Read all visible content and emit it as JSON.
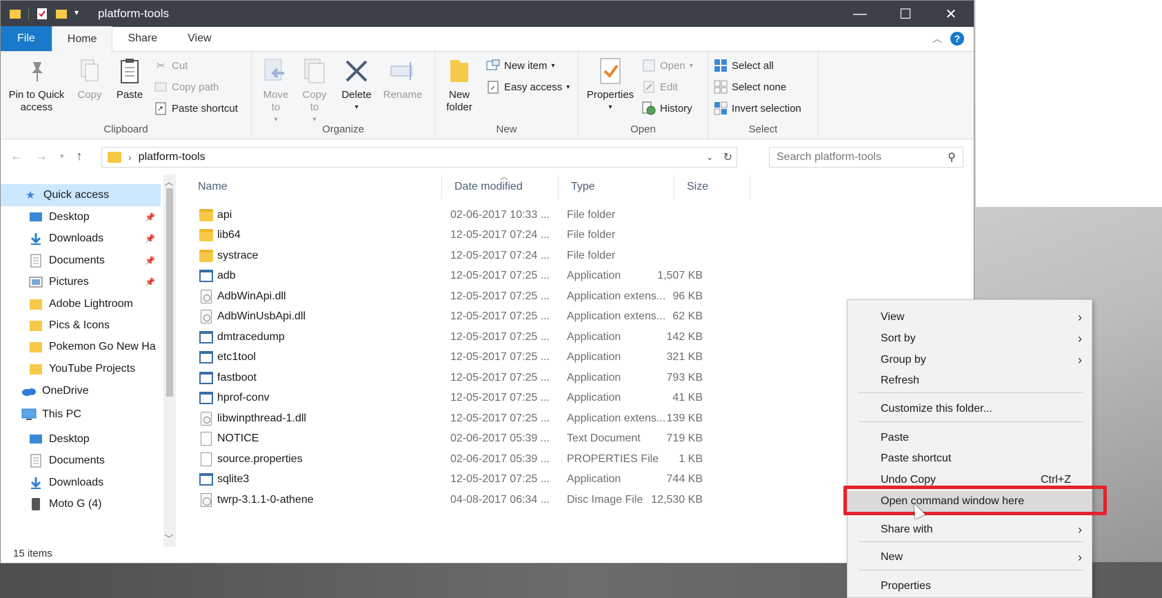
{
  "window": {
    "title": "platform-tools",
    "controls": {
      "minimize": "—",
      "maximize": "☐",
      "close": "✕"
    }
  },
  "ribbon": {
    "tabs": [
      "File",
      "Home",
      "Share",
      "View"
    ],
    "active_tab": "Home",
    "clipboard": {
      "label": "Clipboard",
      "pin": "Pin to Quick access",
      "copy": "Copy",
      "paste": "Paste",
      "cut": "Cut",
      "copy_path": "Copy path",
      "paste_shortcut": "Paste shortcut"
    },
    "organize": {
      "label": "Organize",
      "move_to": "Move to",
      "copy_to": "Copy to",
      "delete": "Delete",
      "rename": "Rename"
    },
    "new": {
      "label": "New",
      "new_folder": "New folder",
      "new_item": "New item",
      "easy_access": "Easy access"
    },
    "open": {
      "label": "Open",
      "properties": "Properties",
      "open": "Open",
      "edit": "Edit",
      "history": "History"
    },
    "select": {
      "label": "Select",
      "select_all": "Select all",
      "select_none": "Select none",
      "invert_selection": "Invert selection"
    }
  },
  "address": {
    "path": "platform-tools",
    "search_placeholder": "Search platform-tools"
  },
  "nav": {
    "quick_access": "Quick access",
    "items": [
      {
        "label": "Desktop",
        "icon": "desktop-icon",
        "pinned": true
      },
      {
        "label": "Downloads",
        "icon": "download-icon",
        "pinned": true
      },
      {
        "label": "Documents",
        "icon": "documents-icon",
        "pinned": true
      },
      {
        "label": "Pictures",
        "icon": "pictures-icon",
        "pinned": true
      },
      {
        "label": "Adobe Lightroom",
        "icon": "folder-icon",
        "pinned": false
      },
      {
        "label": "Pics & Icons",
        "icon": "folder-icon",
        "pinned": false
      },
      {
        "label": "Pokemon Go New Ha",
        "icon": "folder-icon",
        "pinned": false
      },
      {
        "label": "YouTube Projects",
        "icon": "folder-icon",
        "pinned": false
      }
    ],
    "onedrive": "OneDrive",
    "this_pc": "This PC",
    "pc_items": [
      {
        "label": "Desktop",
        "icon": "desktop-icon"
      },
      {
        "label": "Documents",
        "icon": "documents-icon"
      },
      {
        "label": "Downloads",
        "icon": "download-icon"
      },
      {
        "label": "Moto G (4)",
        "icon": "phone-icon"
      }
    ]
  },
  "columns": [
    "Name",
    "Date modified",
    "Type",
    "Size"
  ],
  "files": [
    {
      "name": "api",
      "date": "02-06-2017 10:33 ...",
      "type": "File folder",
      "size": "",
      "icon": "folder"
    },
    {
      "name": "lib64",
      "date": "12-05-2017 07:24 ...",
      "type": "File folder",
      "size": "",
      "icon": "folder"
    },
    {
      "name": "systrace",
      "date": "12-05-2017 07:24 ...",
      "type": "File folder",
      "size": "",
      "icon": "folder"
    },
    {
      "name": "adb",
      "date": "12-05-2017 07:25 ...",
      "type": "Application",
      "size": "1,507 KB",
      "icon": "app"
    },
    {
      "name": "AdbWinApi.dll",
      "date": "12-05-2017 07:25 ...",
      "type": "Application extens...",
      "size": "96 KB",
      "icon": "dll"
    },
    {
      "name": "AdbWinUsbApi.dll",
      "date": "12-05-2017 07:25 ...",
      "type": "Application extens...",
      "size": "62 KB",
      "icon": "dll"
    },
    {
      "name": "dmtracedump",
      "date": "12-05-2017 07:25 ...",
      "type": "Application",
      "size": "142 KB",
      "icon": "app"
    },
    {
      "name": "etc1tool",
      "date": "12-05-2017 07:25 ...",
      "type": "Application",
      "size": "321 KB",
      "icon": "app"
    },
    {
      "name": "fastboot",
      "date": "12-05-2017 07:25 ...",
      "type": "Application",
      "size": "793 KB",
      "icon": "app"
    },
    {
      "name": "hprof-conv",
      "date": "12-05-2017 07:25 ...",
      "type": "Application",
      "size": "41 KB",
      "icon": "app"
    },
    {
      "name": "libwinpthread-1.dll",
      "date": "12-05-2017 07:25 ...",
      "type": "Application extens...",
      "size": "139 KB",
      "icon": "dll"
    },
    {
      "name": "NOTICE",
      "date": "02-06-2017 05:39 ...",
      "type": "Text Document",
      "size": "719 KB",
      "icon": "doc"
    },
    {
      "name": "source.properties",
      "date": "02-06-2017 05:39 ...",
      "type": "PROPERTIES File",
      "size": "1 KB",
      "icon": "doc"
    },
    {
      "name": "sqlite3",
      "date": "12-05-2017 07:25 ...",
      "type": "Application",
      "size": "744 KB",
      "icon": "app"
    },
    {
      "name": "twrp-3.1.1-0-athene",
      "date": "04-08-2017 06:34 ...",
      "type": "Disc Image File",
      "size": "12,530 KB",
      "icon": "disc"
    }
  ],
  "status": "15 items",
  "context_menu": {
    "items": [
      {
        "label": "View",
        "submenu": true
      },
      {
        "label": "Sort by",
        "submenu": true
      },
      {
        "label": "Group by",
        "submenu": true
      },
      {
        "label": "Refresh",
        "submenu": false
      },
      {
        "label": "Customize this folder...",
        "submenu": false
      },
      {
        "label": "Paste",
        "submenu": false
      },
      {
        "label": "Paste shortcut",
        "submenu": false
      },
      {
        "label": "Undo Copy",
        "submenu": false,
        "shortcut": "Ctrl+Z"
      },
      {
        "label": "Open command window here",
        "submenu": false,
        "highlighted": true
      },
      {
        "label": "Share with",
        "submenu": true
      },
      {
        "label": "New",
        "submenu": true
      },
      {
        "label": "Properties",
        "submenu": false
      }
    ]
  },
  "colors": {
    "accent": "#1979ca",
    "highlight_border": "#e3232c",
    "selection": "#cce8ff",
    "titlebar": "#3c4149"
  }
}
